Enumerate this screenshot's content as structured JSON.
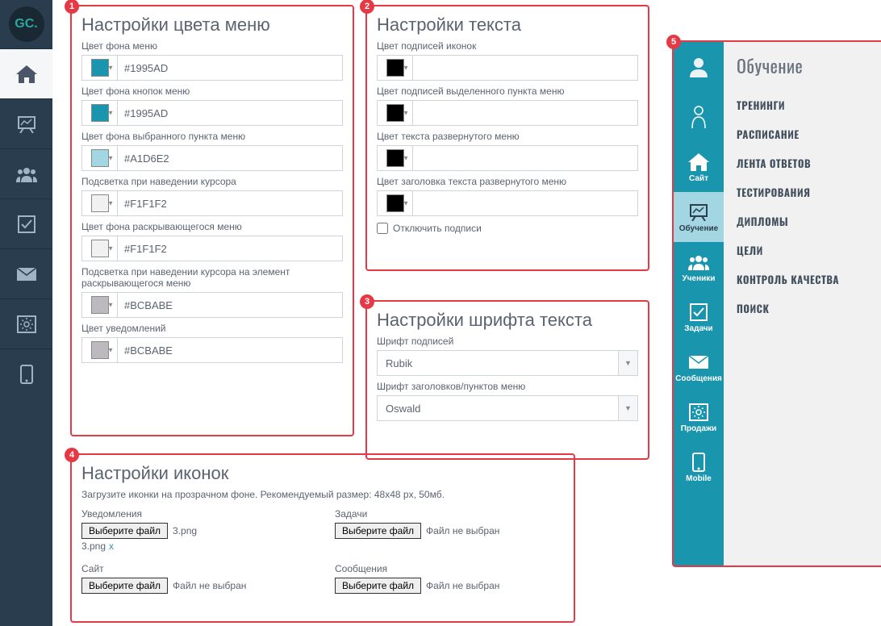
{
  "left_sidebar": {
    "logo_text": "GC."
  },
  "panel1": {
    "badge": "1",
    "title": "Настройки цвета меню",
    "fields": [
      {
        "label": "Цвет фона меню",
        "value": "#1995AD",
        "swatch": "#1995AD"
      },
      {
        "label": "Цвет фона кнопок меню",
        "value": "#1995AD",
        "swatch": "#1995AD"
      },
      {
        "label": "Цвет фона выбранного пункта меню",
        "value": "#A1D6E2",
        "swatch": "#A1D6E2"
      },
      {
        "label": "Подсветка при наведении курсора",
        "value": "#F1F1F2",
        "swatch": "#F1F1F2"
      },
      {
        "label": "Цвет фона раскрывающегося меню",
        "value": "#F1F1F2",
        "swatch": "#F1F1F2"
      },
      {
        "label": "Подсветка при наведении курсора на элемент раскрывающегося меню",
        "value": "#BCBABE",
        "swatch": "#BCBABE"
      },
      {
        "label": "Цвет уведомлений",
        "value": "#BCBABE",
        "swatch": "#BCBABE"
      }
    ]
  },
  "panel2": {
    "badge": "2",
    "title": "Настройки текста",
    "fields": [
      {
        "label": "Цвет подписей иконок",
        "value": "",
        "swatch": "#000000"
      },
      {
        "label": "Цвет подписей выделенного пункта меню",
        "value": "",
        "swatch": "#000000"
      },
      {
        "label": "Цвет текста развернутого меню",
        "value": "",
        "swatch": "#000000"
      },
      {
        "label": "Цвет заголовка текста развернутого меню",
        "value": "",
        "swatch": "#000000"
      }
    ],
    "checkbox_label": "Отключить подписи"
  },
  "panel3": {
    "badge": "3",
    "title": "Настройки шрифта текста",
    "fields": [
      {
        "label": "Шрифт подписей",
        "value": "Rubik"
      },
      {
        "label": "Шрифт заголовков/пунктов меню",
        "value": "Oswald"
      }
    ]
  },
  "panel4": {
    "badge": "4",
    "title": "Настройки иконок",
    "hint": "Загрузите иконки на прозрачном фоне. Рекомендуемый размер: 48х48 px, 50мб.",
    "file_button_label": "Выберите файл",
    "no_file_label": "Файл не выбран",
    "items": [
      {
        "label": "Уведомления",
        "status": "3.png",
        "sub_name": "3.png",
        "has_file": true
      },
      {
        "label": "Задачи",
        "status": "Файл не выбран",
        "has_file": false
      },
      {
        "label": "Сайт",
        "status": "Файл не выбран",
        "has_file": false
      },
      {
        "label": "Сообщения",
        "status": "Файл не выбран",
        "has_file": false
      }
    ],
    "remove_label": "x"
  },
  "panel5": {
    "badge": "5",
    "sidebar_items": [
      {
        "label": "",
        "icon": "user"
      },
      {
        "label": "",
        "icon": "person"
      },
      {
        "label": "Сайт",
        "icon": "home"
      },
      {
        "label": "Обучение",
        "icon": "board",
        "selected": true
      },
      {
        "label": "Ученики",
        "icon": "users"
      },
      {
        "label": "Задачи",
        "icon": "check"
      },
      {
        "label": "Сообщения",
        "icon": "mail"
      },
      {
        "label": "Продажи",
        "icon": "gear-box"
      },
      {
        "label": "Mobile",
        "icon": "phone"
      }
    ],
    "expand_title": "Обучение",
    "expand_items": [
      "ТРЕНИНГИ",
      "РАСПИСАНИЕ",
      "ЛЕНТА ОТВЕТОВ",
      "ТЕСТИРОВАНИЯ",
      "ДИПЛОМЫ",
      "ЦЕЛИ",
      "КОНТРОЛЬ КАЧЕСТВА",
      "ПОИСК"
    ]
  }
}
